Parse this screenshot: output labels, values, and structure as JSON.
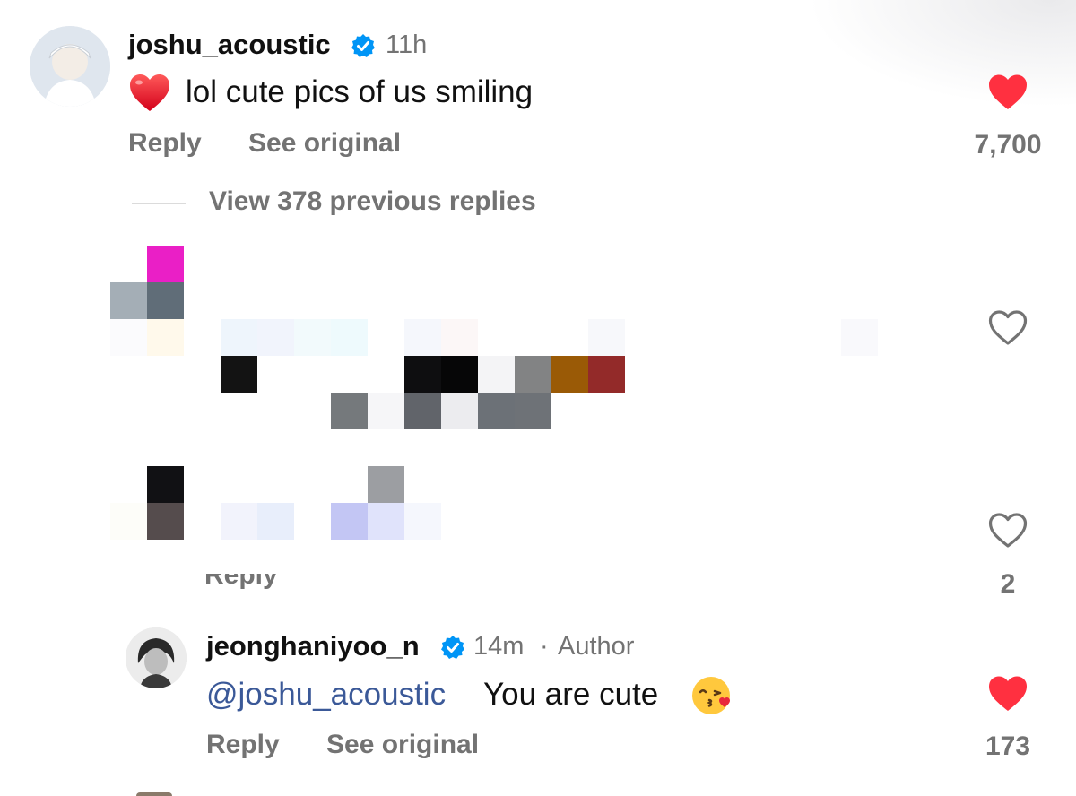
{
  "comment1": {
    "username": "joshu_acoustic",
    "time": "11h",
    "emoji": "❤️",
    "text": "lol cute pics of us smiling",
    "reply_label": "Reply",
    "see_original_label": "See original",
    "like_count": "7,700",
    "liked": true
  },
  "thread": {
    "view_replies_label": "View 378 previous replies"
  },
  "hidden_reply_a": {
    "liked": false
  },
  "hidden_reply_b": {
    "reply_label_partial": "Reply",
    "like_count": "2",
    "liked": false
  },
  "comment2": {
    "username": "jeonghaniyoo_n",
    "time": "14m",
    "separator": "·",
    "author_label": "Author",
    "mention": "@joshu_acoustic",
    "text": "You are cute",
    "emoji": "😘",
    "reply_label": "Reply",
    "see_original_label": "See original",
    "like_count": "173",
    "liked": true
  },
  "colors": {
    "heart_filled": "#ff3040",
    "verified": "#0095f6",
    "mention": "#3b5998",
    "muted": "#737373"
  }
}
